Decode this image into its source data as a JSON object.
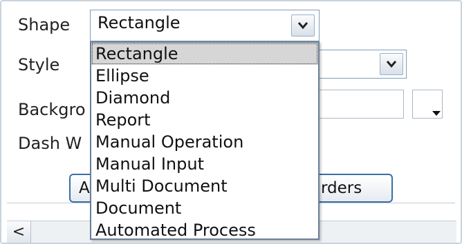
{
  "form": {
    "shape_label": "Shape",
    "style_label": "Style",
    "background_label": "Backgro",
    "dash_label": "Dash W",
    "shape_select": {
      "selected": "Rectangle",
      "options": [
        "Rectangle",
        "Ellipse",
        "Diamond",
        "Report",
        "Manual Operation",
        "Manual Input",
        "Multi Document",
        "Document",
        "Automated Process"
      ]
    },
    "left_button_label": "A",
    "borders_button_label": "rders"
  },
  "scrollbar": {
    "left_arrow": "<"
  }
}
